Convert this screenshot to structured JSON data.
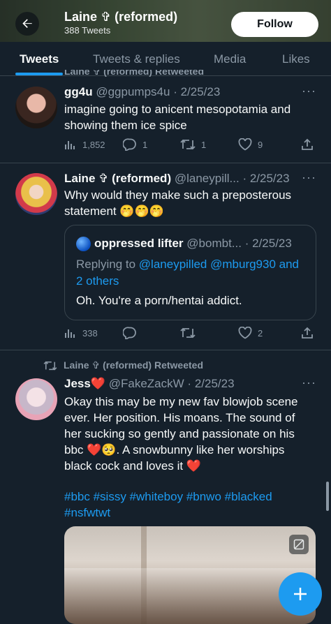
{
  "header": {
    "title": "Laine ✞ (reformed)",
    "tweet_count": "388 Tweets",
    "follow_label": "Follow"
  },
  "tabs": [
    {
      "label": "Tweets",
      "active": true
    },
    {
      "label": "Tweets & replies",
      "active": false
    },
    {
      "label": "Media",
      "active": false
    },
    {
      "label": "Likes",
      "active": false
    }
  ],
  "partial_retweet_label": "Laine ✞ (reformed) Retweeted",
  "tweets": [
    {
      "name": "gg4u",
      "handle": "@ggpumps4u",
      "separator": "·",
      "date": "2/25/23",
      "text_lines": [
        "imagine going to anicent mesopotamia and",
        "showing them ice spice"
      ],
      "views": "1,852",
      "replies": "1",
      "retweets": "1",
      "likes": "9"
    },
    {
      "name": "Laine ✞ (reformed)",
      "handle": "@laneypill...",
      "separator": "·",
      "date": "2/25/23",
      "text_lines": [
        "Why would they make such a preposterous",
        "statement 🤭🤭🤭"
      ],
      "quote": {
        "name": "oppressed lifter",
        "handle": "@bombt...",
        "separator": "·",
        "date": "2/25/23",
        "replying_prefix": "Replying to",
        "replying_to": "@laneypilled @mburg930 and",
        "replying_more": "2 others",
        "text": "Oh. You're a porn/hentai addict."
      },
      "views": "338",
      "replies": "",
      "retweets": "",
      "likes": "2"
    },
    {
      "retweet_label": "Laine ✞ (reformed) Retweeted",
      "name": "Jess❤️",
      "handle": "@FakeZackW",
      "separator": "·",
      "date": "2/25/23",
      "text_lines": [
        "Okay this may be my new fav blowjob scene",
        "ever. Her position. His moans. The sound of",
        "her sucking so gently and passionate on his",
        "bbc ❤️🥺. A snowbunny like her worships",
        "black cock and loves it ❤️"
      ],
      "hashtags_line1": "#bbc #sissy #whiteboy #bnwo #blacked",
      "hashtags_line2": "#nsfwtwt"
    }
  ],
  "colors": {
    "background": "#15202b",
    "accent": "#1d9bf0",
    "secondary_text": "#8b98a5",
    "divider": "#38444d"
  },
  "icons": [
    "back-arrow-icon",
    "views-icon",
    "reply-icon",
    "retweet-icon",
    "like-icon",
    "share-icon",
    "more-icon",
    "sensitive-media-icon",
    "compose-plus-icon",
    "verified-badge-icon"
  ]
}
